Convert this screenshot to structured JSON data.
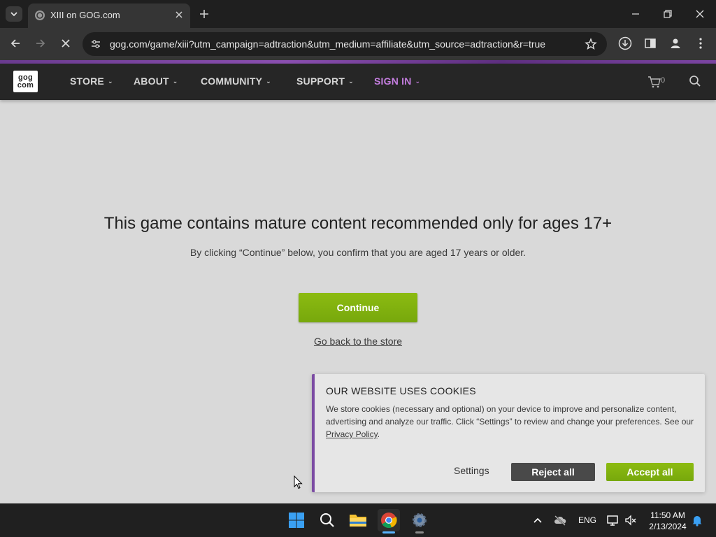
{
  "browser": {
    "tab_title": "XIII on GOG.com",
    "url": "gog.com/game/xiii?utm_campaign=adtraction&utm_medium=affiliate&utm_source=adtraction&r=true"
  },
  "gog": {
    "logo_top": "gog",
    "logo_bottom": "com",
    "nav": [
      "STORE",
      "ABOUT",
      "COMMUNITY",
      "SUPPORT",
      "SIGN IN"
    ],
    "cart_count": "0"
  },
  "age_gate": {
    "title": "This game contains mature content recommended only for ages 17+",
    "text": "By clicking “Continue” below, you confirm that you are aged 17 years or older.",
    "continue_label": "Continue",
    "back_label": "Go back to the store"
  },
  "cookie": {
    "title": "OUR WEBSITE USES COOKIES",
    "text": "We store cookies (necessary and optional) on your device to improve and personalize content, advertising and analyze our traffic. Click “Settings” to review and change your preferences. See our",
    "privacy_link": "Privacy Policy",
    "text_end": ".",
    "settings_label": "Settings",
    "reject_label": "Reject all",
    "accept_label": "Accept all"
  },
  "taskbar": {
    "lang": "ENG",
    "time": "11:50 AM",
    "date": "2/13/2024"
  },
  "colors": {
    "accent_green": "#7fb10e",
    "signin_purple": "#c57ee0",
    "cookie_border": "#7b4ba3"
  }
}
